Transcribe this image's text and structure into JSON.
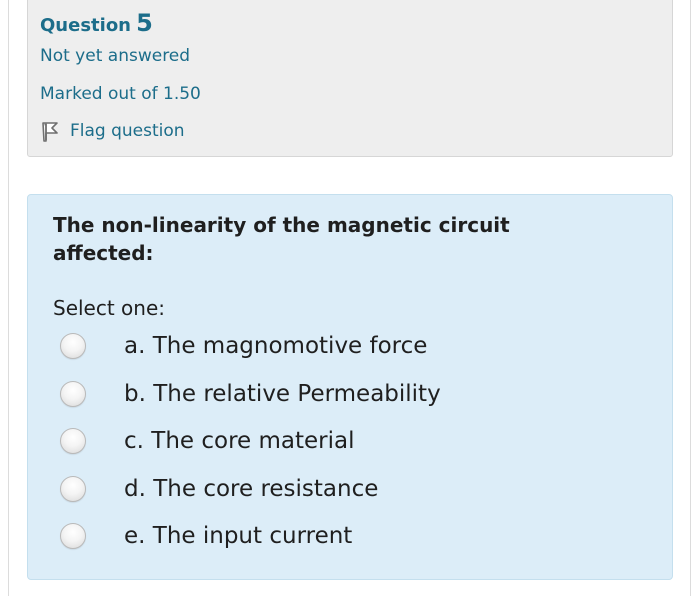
{
  "question_info": {
    "label": "Question",
    "number": "5",
    "state": "Not yet answered",
    "grade": "Marked out of 1.50",
    "flag_label": "Flag question",
    "flag_icon": "flag-icon"
  },
  "question": {
    "text": "The non-linearity of the magnetic circuit affected:",
    "prompt": "Select one:",
    "options": [
      {
        "letter": "a.",
        "text": "The magnomotive force",
        "selected": false
      },
      {
        "letter": "b.",
        "text": "The relative Permeability",
        "selected": false
      },
      {
        "letter": "c.",
        "text": "The core material",
        "selected": false
      },
      {
        "letter": "d.",
        "text": "The core resistance",
        "selected": false
      },
      {
        "letter": "e.",
        "text": "The input current",
        "selected": false
      }
    ]
  },
  "colors": {
    "link_blue": "#1c6d8a",
    "info_bg": "#eeeeee",
    "content_bg": "#dcedf8",
    "text": "#1f1f1f"
  }
}
